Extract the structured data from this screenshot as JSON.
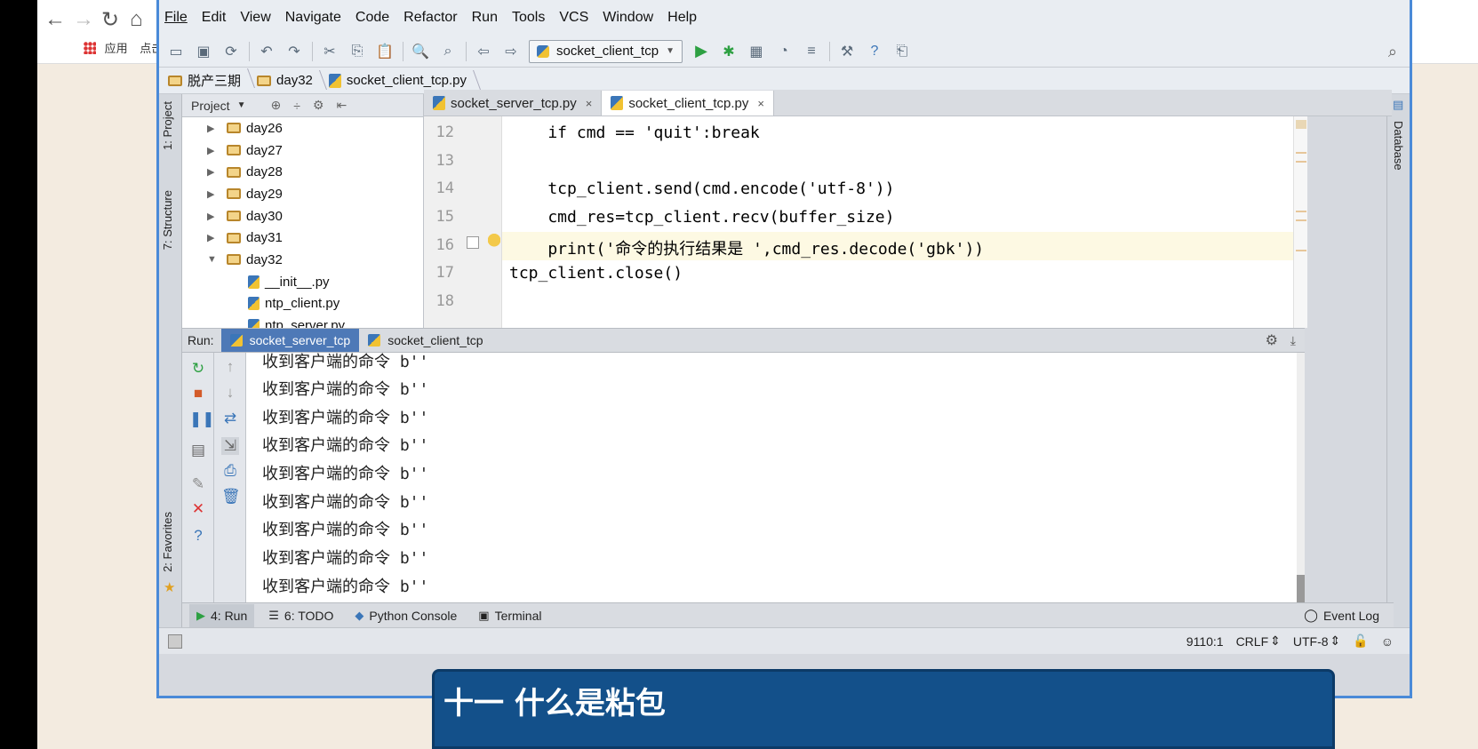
{
  "browser": {
    "bookmarks": [
      "应用",
      "点击这里"
    ]
  },
  "menu": [
    "File",
    "Edit",
    "View",
    "Navigate",
    "Code",
    "Refactor",
    "Run",
    "Tools",
    "VCS",
    "Window",
    "Help"
  ],
  "toolbar": {
    "run_config": "socket_client_tcp"
  },
  "breadcrumb": [
    "脱产三期",
    "day32",
    "socket_client_tcp.py"
  ],
  "project_panel": {
    "title": "Project",
    "tree": [
      {
        "label": "day26",
        "type": "folder",
        "expanded": false
      },
      {
        "label": "day27",
        "type": "folder",
        "expanded": false
      },
      {
        "label": "day28",
        "type": "folder",
        "expanded": false
      },
      {
        "label": "day29",
        "type": "folder",
        "expanded": false
      },
      {
        "label": "day30",
        "type": "folder",
        "expanded": false
      },
      {
        "label": "day31",
        "type": "folder",
        "expanded": false
      },
      {
        "label": "day32",
        "type": "folder",
        "expanded": true
      },
      {
        "label": "__init__.py",
        "type": "file"
      },
      {
        "label": "ntp_client.py",
        "type": "file"
      },
      {
        "label": "ntp_server.py",
        "type": "file"
      }
    ]
  },
  "side_tabs": {
    "project": "1: Project",
    "structure": "7: Structure",
    "favorites": "2: Favorites",
    "database": "Database"
  },
  "editor": {
    "tabs": [
      {
        "label": "socket_server_tcp.py",
        "active": false
      },
      {
        "label": "socket_client_tcp.py",
        "active": true
      }
    ],
    "line_numbers": [
      "12",
      "13",
      "14",
      "15",
      "16",
      "17",
      "18"
    ],
    "lines": [
      "    if cmd == 'quit':break",
      "",
      "    tcp_client.send(cmd.encode('utf-8'))",
      "    cmd_res=tcp_client.recv(buffer_size)",
      "    print('命令的执行结果是 ',cmd_res.decode('gbk'))",
      "tcp_client.close()",
      ""
    ]
  },
  "run_panel": {
    "label": "Run:",
    "tabs": [
      {
        "label": "socket_server_tcp",
        "active": true
      },
      {
        "label": "socket_client_tcp",
        "active": false
      }
    ],
    "output": [
      "收到客户端的命令 b''",
      "收到客户端的命令 b''",
      "收到客户端的命令 b''",
      "收到客户端的命令 b''",
      "收到客户端的命令 b''",
      "收到客户端的命令 b''",
      "收到客户端的命令 b''",
      "收到客户端的命令 b''",
      "收到客户端的命令 b''"
    ]
  },
  "bottom_tabs": [
    "4: Run",
    "6: TODO",
    "Python Console",
    "Terminal"
  ],
  "event_log": "Event Log",
  "status": {
    "position": "9110:1",
    "line_sep": "CRLF",
    "encoding": "UTF-8"
  },
  "banner": {
    "title": "十一 什么是粘包"
  },
  "colors": {
    "accent": "#4e79b7",
    "keyword": "#000080",
    "string": "#008000",
    "banner": "#13508a"
  }
}
